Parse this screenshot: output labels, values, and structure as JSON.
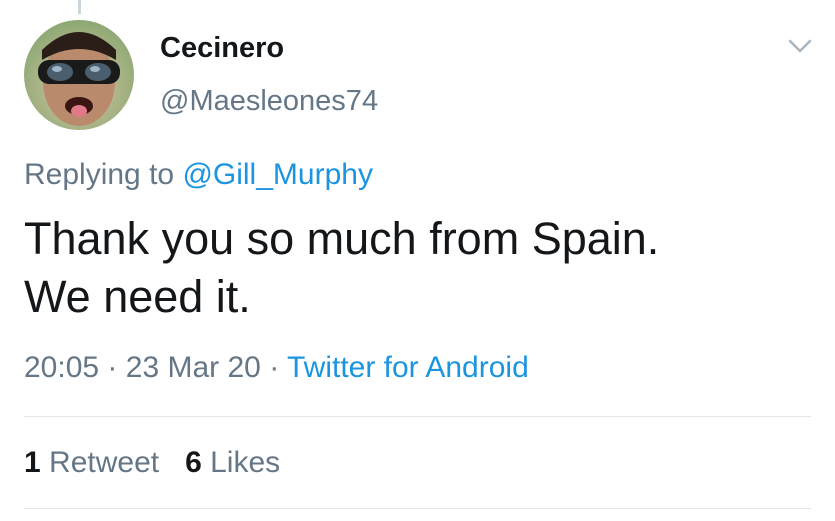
{
  "tweet": {
    "display_name": "Cecinero",
    "handle": "@Maesleones74",
    "replying_prefix": "Replying to",
    "replying_to": "@Gill_Murphy",
    "text_line1": "Thank you so much from Spain.",
    "text_line2": "We need it.",
    "time": "20:05",
    "date": "23 Mar 20",
    "separator": "·",
    "source": "Twitter for Android",
    "retweet_count": "1",
    "retweet_label": "Retweet",
    "like_count": "6",
    "like_label": "Likes"
  },
  "icons": {
    "menu": "chevron-down-icon"
  },
  "colors": {
    "link": "#1b95e0",
    "secondary_text": "#657786",
    "primary_text": "#14171a",
    "divider": "#e1e8ed"
  }
}
